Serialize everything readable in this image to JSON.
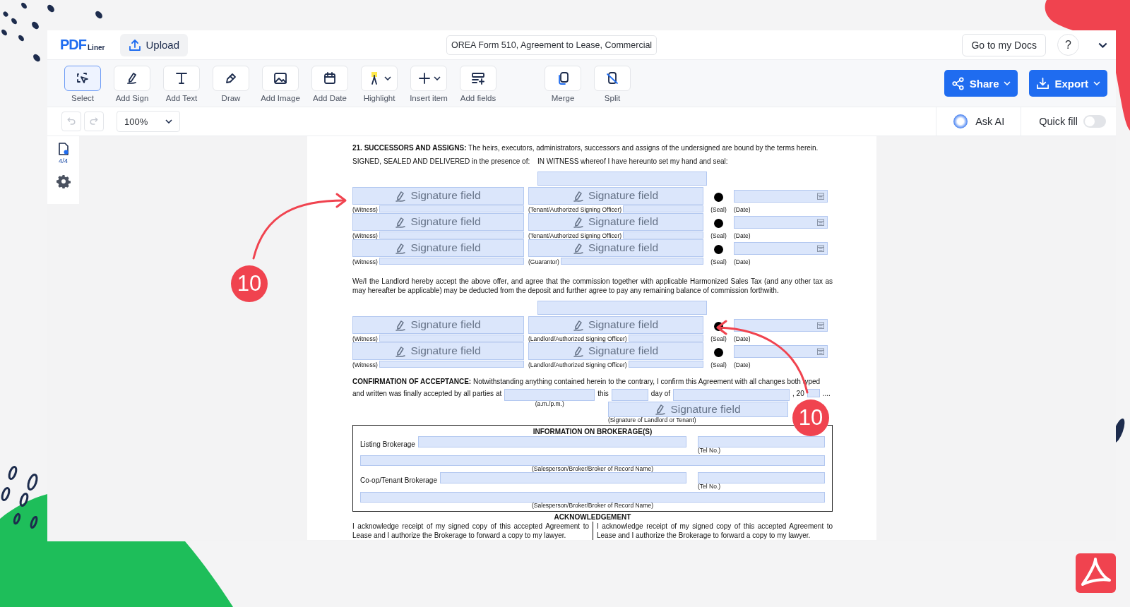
{
  "top_bar": {
    "logo": {
      "main": "PDF",
      "sub": "Liner"
    },
    "upload": "Upload",
    "document_title": "OREA Form 510, Agreement to Lease, Commercial",
    "docs_button": "Go to my Docs",
    "help": "?"
  },
  "tools": [
    {
      "label": "Select",
      "selected": true,
      "kind": "tool"
    },
    {
      "label": "Add Sign",
      "selected": false,
      "kind": "tool"
    },
    {
      "label": "Add Text",
      "selected": false,
      "kind": "tool"
    },
    {
      "label": "Draw",
      "selected": false,
      "kind": "tool"
    },
    {
      "label": "Add Image",
      "selected": false,
      "kind": "tool"
    },
    {
      "label": "Add Date",
      "selected": false,
      "kind": "tool"
    },
    {
      "label": "Highlight",
      "selected": false,
      "kind": "menu"
    },
    {
      "label": "Insert item",
      "selected": false,
      "kind": "menu"
    },
    {
      "label": "Add fields",
      "selected": false,
      "kind": "tool"
    }
  ],
  "page_tools": [
    {
      "label": "Merge"
    },
    {
      "label": "Split"
    }
  ],
  "actions": [
    {
      "label": "Share"
    },
    {
      "label": "Export"
    }
  ],
  "history": [
    {
      "kind": "undo",
      "disabled": true
    },
    {
      "kind": "redo",
      "disabled": true
    }
  ],
  "zoom": {
    "value": "100%"
  },
  "ask_ai": "Ask AI",
  "quick_fill": {
    "label": "Quick fill",
    "on": false
  },
  "sidebar": {
    "page_count": "4/4"
  },
  "document": {
    "clause": "**21. SUCCESSORS AND ASSIGNS:** The heirs, executors, administrators, successors and assigns of the undersigned are bound by the terms herein.",
    "witness_intro": "SIGNED, SEALED AND DELIVERED in the presence of:",
    "seal_intro": "IN WITNESS whereof I have hereunto set my hand and seal:",
    "tenant_rows": [
      {
        "witness_field": "Signature field",
        "witness_label": "(Witness)",
        "signer_field": "Signature field",
        "signer_label": "(Tenant/Authorized Signing Officer)",
        "seal_label": "(Seal)",
        "date_label": "(Date)"
      },
      {
        "witness_field": "Signature field",
        "witness_label": "(Witness)",
        "signer_field": "Signature field",
        "signer_label": "(Tenant/Authorized Signing Officer)",
        "seal_label": "(Seal)",
        "date_label": "(Date)"
      },
      {
        "witness_field": "Signature field",
        "witness_label": "(Witness)",
        "signer_field": "Signature field",
        "signer_label": "(Guarantor)",
        "seal_label": "(Seal)",
        "date_label": "(Date)"
      }
    ],
    "landlord_text": "We/I the Landlord hereby accept the above offer, and agree that the commission together with applicable Harmonized Sales Tax (and any other tax as may hereafter be applicable) may be deducted from the deposit and further agree to pay any remaining balance of commission forthwith.",
    "landlord_rows": [
      {
        "witness_field": "Signature field",
        "witness_label": "(Witness)",
        "signer_field": "Signature field",
        "signer_label": "(Landlord/Authorized Signing Officer)",
        "seal_label": "(Seal)",
        "date_label": "(Date)"
      },
      {
        "witness_field": "Signature field",
        "witness_label": "(Witness)",
        "signer_field": "Signature field",
        "signer_label": "(Landlord/Authorized Signing Officer)",
        "seal_label": "(Seal)",
        "date_label": "(Date)"
      }
    ],
    "confirmation": {
      "text": "**CONFIRMATION OF ACCEPTANCE:** Notwithstanding anything contained herein to the contrary, I confirm this Agreement with all changes both typed",
      "time_prefix": "and written was finally accepted by all parties at",
      "time_label": "(a.m./p.m.)",
      "day_prefix": "this",
      "month_prefix": "day of",
      "year_prefix": ", 20",
      "ending": "....",
      "signature_field": "Signature field",
      "signature_label": "(Signature of Landlord or Tenant)"
    },
    "brokerage": {
      "title": "INFORMATION ON BROKERAGE(S)",
      "rows": [
        {
          "label": "Listing Brokerage",
          "phone_label": "(Tel No.)",
          "agent_label": "(Salesperson/Broker/Broker of Record Name)"
        },
        {
          "label": "Co-op/Tenant Brokerage",
          "phone_label": "(Tel No.)",
          "agent_label": "(Salesperson/Broker/Broker of Record Name)"
        }
      ]
    },
    "acknowledgement": {
      "title": "ACKNOWLEDGEMENT",
      "columns": [
        "I acknowledge receipt of my signed copy of this accepted Agreement to Lease and I authorize the Brokerage to forward a copy to my lawyer.",
        "I acknowledge receipt of my signed copy of this accepted Agreement to Lease and I authorize the Brokerage to forward a copy to my lawyer."
      ]
    }
  },
  "annotations": [
    {
      "label": "10"
    },
    {
      "label": "10"
    }
  ]
}
